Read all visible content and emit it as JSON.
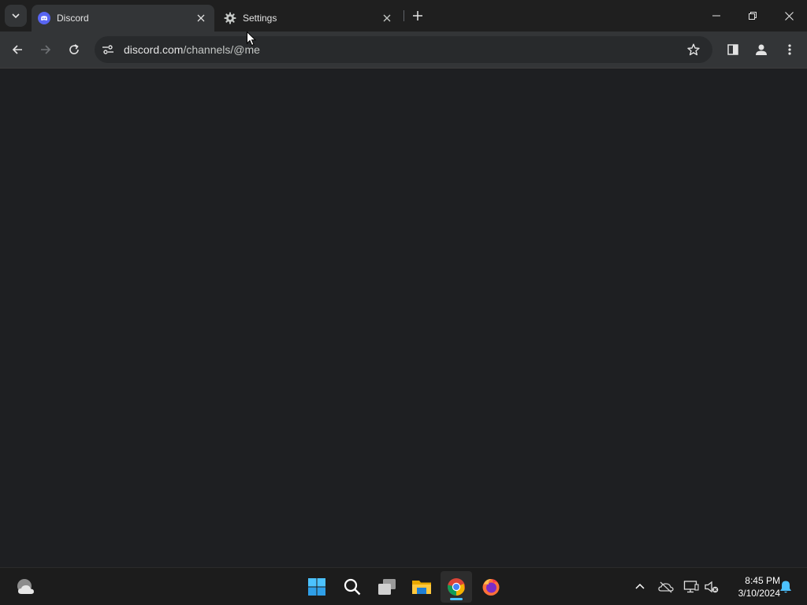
{
  "browser": {
    "tabs": [
      {
        "title": "Discord",
        "favicon": "discord-icon",
        "active": true
      },
      {
        "title": "Settings",
        "favicon": "gear-icon",
        "active": false
      }
    ],
    "address": {
      "host": "discord.com",
      "path": "/channels/@me"
    }
  },
  "taskbar": {
    "apps": [
      "weather-icon",
      "windows-start-icon",
      "search-icon",
      "task-view-icon",
      "file-explorer-icon",
      "chrome-icon",
      "firefox-icon"
    ],
    "clock": {
      "time": "8:45 PM",
      "date": "3/10/2024"
    }
  },
  "colors": {
    "discord_blurple": "#5865f2",
    "page_bg": "#1e1f22",
    "accent": "#4cc2ff"
  }
}
